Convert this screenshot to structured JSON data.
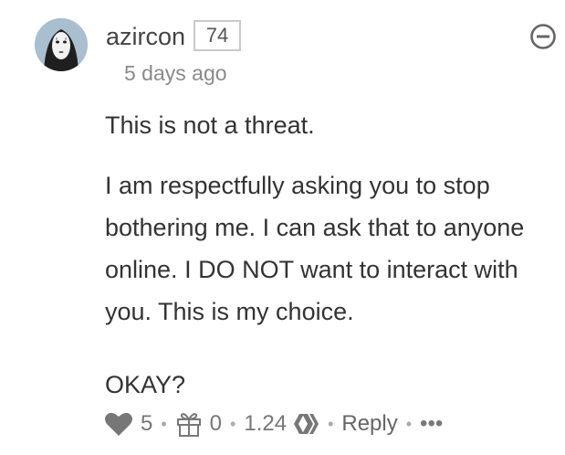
{
  "comment": {
    "author": "azircon",
    "reputation": "74",
    "timestamp": "5 days ago",
    "paragraphs": [
      "This is not a threat.",
      "I am respectfully asking you to stop bothering me. I can ask that to anyone online. I DO NOT want to interact with you. This is my choice.",
      "OKAY?"
    ]
  },
  "footer": {
    "votes": "5",
    "gifts": "0",
    "payout": "1.24",
    "reply_label": "Reply",
    "more_label": "•••"
  },
  "icons": {
    "avatar": "masked-character-avatar",
    "collapse": "minus-circle-icon",
    "vote": "heart-icon",
    "gift": "gift-icon",
    "payout": "hive-logo-icon"
  },
  "colors": {
    "text": "#333333",
    "muted": "#8a8a8a",
    "icon": "#777777",
    "badge_border": "#c9c9c9"
  }
}
